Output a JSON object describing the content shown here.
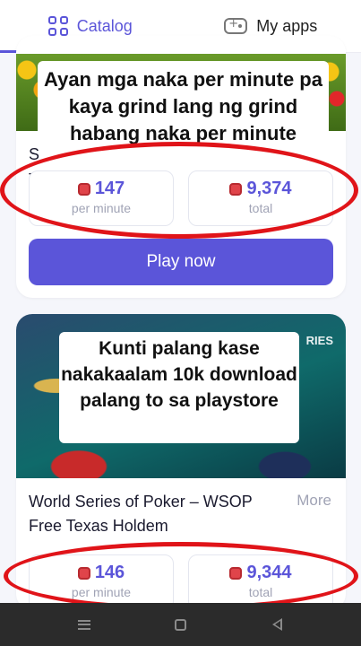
{
  "tabs": {
    "catalog": {
      "label": "Catalog",
      "icon": "grid-icon",
      "active": true
    },
    "my_apps": {
      "label": "My apps",
      "icon": "gamepad-icon",
      "active": false
    }
  },
  "card1": {
    "title_fragment_line1": "S",
    "title_fragment_line2": "T",
    "per_minute": {
      "value": "147",
      "label": "per minute"
    },
    "total": {
      "value": "9,374",
      "label": "total"
    },
    "play_button": "Play now"
  },
  "card2": {
    "image_sign": "RIES",
    "title": "World Series of Poker – WSOP Free Texas Holdem",
    "more_link": "More",
    "per_minute": {
      "value": "146",
      "label": "per minute"
    },
    "total": {
      "value": "9,344",
      "label": "total"
    }
  },
  "overlays": {
    "note1": "Ayan mga naka per minute pa kaya grind lang ng grind habang naka per minute",
    "note2": "Kunti palang kase nakakaalam 10k download palang to sa playstore"
  },
  "colors": {
    "accent": "#5b55d9",
    "annotation_red": "#e01419",
    "gem_red": "#e0444a",
    "muted_text": "#a0a3b5"
  }
}
